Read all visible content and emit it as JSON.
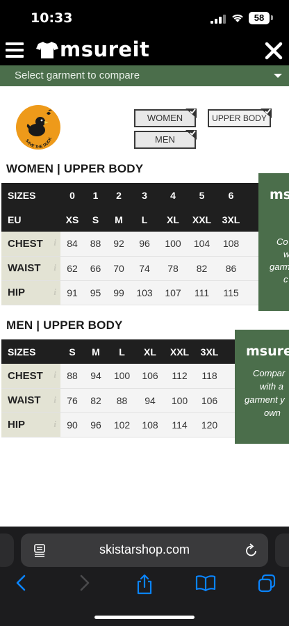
{
  "status": {
    "time": "10:33",
    "battery": "58"
  },
  "header": {
    "logo": "msureit"
  },
  "select": {
    "placeholder": "Select garment to compare"
  },
  "brand": {
    "name": "SAVE THE DUCK"
  },
  "filters": {
    "women": "WOMEN",
    "upper": "UPPER BODY",
    "men": "MEN"
  },
  "women": {
    "title": "WOMEN | UPPER BODY",
    "sizes_label": "SIZES",
    "sizes": [
      "0",
      "1",
      "2",
      "3",
      "4",
      "5",
      "6"
    ],
    "eu_label": "EU",
    "eu": [
      "XS",
      "S",
      "M",
      "L",
      "XL",
      "XXL",
      "3XL"
    ],
    "rows": [
      {
        "label": "CHEST",
        "values": [
          "84",
          "88",
          "92",
          "96",
          "100",
          "104",
          "108"
        ]
      },
      {
        "label": "WAIST",
        "values": [
          "62",
          "66",
          "70",
          "74",
          "78",
          "82",
          "86"
        ]
      },
      {
        "label": "HIP",
        "values": [
          "91",
          "95",
          "99",
          "103",
          "107",
          "111",
          "115"
        ]
      }
    ]
  },
  "men": {
    "title": "MEN | UPPER BODY",
    "sizes_label": "SIZES",
    "sizes": [
      "S",
      "M",
      "L",
      "XL",
      "XXL",
      "3XL"
    ],
    "rows": [
      {
        "label": "CHEST",
        "values": [
          "88",
          "94",
          "100",
          "106",
          "112",
          "118"
        ]
      },
      {
        "label": "WAIST",
        "values": [
          "76",
          "82",
          "88",
          "94",
          "100",
          "106"
        ]
      },
      {
        "label": "HIP",
        "values": [
          "90",
          "96",
          "102",
          "108",
          "114",
          "120"
        ]
      }
    ]
  },
  "promo1": {
    "title": "msu",
    "lines": [
      "Co",
      "w",
      "garm",
      "c"
    ]
  },
  "promo2": {
    "title": "msure",
    "lines": [
      "Compar",
      "with a",
      "garment y",
      "own"
    ]
  },
  "browser": {
    "domain": "skistarshop.com"
  },
  "info_glyph": "i",
  "colors": {
    "accent_green": "#4b6e4b",
    "header_bg": "#000000",
    "table_dark": "#1f1f1f",
    "label_bg": "#e3e3d4",
    "brand_orange": "#ee9a1a",
    "ios_blue": "#0a84ff"
  }
}
